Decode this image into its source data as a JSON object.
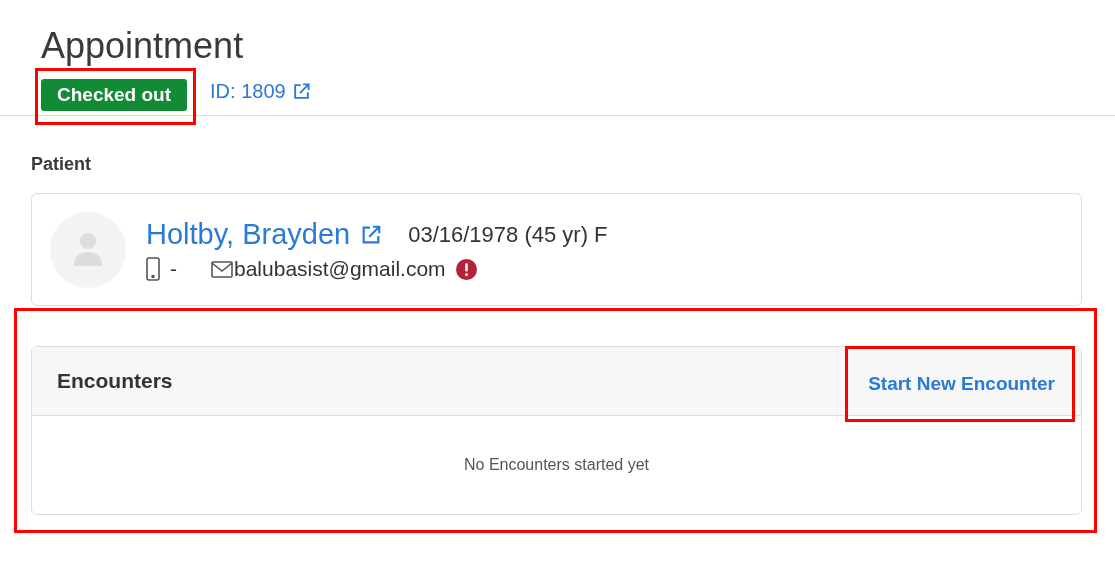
{
  "title": "Appointment",
  "status": {
    "label": "Checked out",
    "highlighted": true
  },
  "appointment_id": {
    "label": "ID: 1809"
  },
  "patient_section": {
    "label": "Patient"
  },
  "patient": {
    "name": "Holtby, Brayden",
    "birth_info": "03/16/1978 (45 yr) F",
    "phone": "-",
    "email": "balubasist@gmail.com",
    "email_warning": true
  },
  "encounters": {
    "title": "Encounters",
    "highlighted": true,
    "action": {
      "label": "Start New Encounter",
      "highlighted": true
    },
    "empty_message": "No Encounters started yet"
  }
}
